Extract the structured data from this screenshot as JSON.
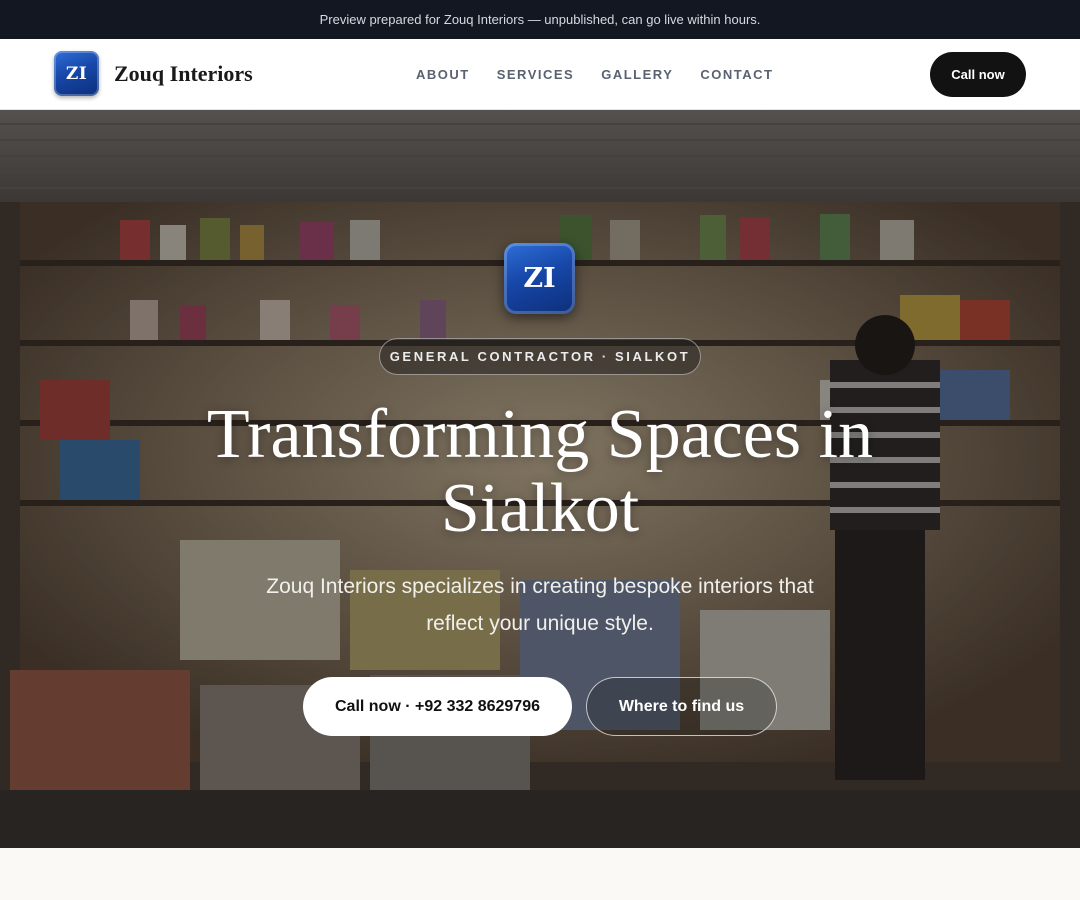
{
  "preview_bar": {
    "text": "Preview prepared for Zouq Interiors — unpublished, can go live within hours."
  },
  "header": {
    "logo_text": "ZI",
    "brand_name": "Zouq Interiors",
    "nav": [
      {
        "label": "ABOUT"
      },
      {
        "label": "SERVICES"
      },
      {
        "label": "GALLERY"
      },
      {
        "label": "CONTACT"
      }
    ],
    "call_label": "Call now"
  },
  "hero": {
    "logo_text": "ZI",
    "eyebrow": "GENERAL CONTRACTOR · SIALKOT",
    "title": "Transforming Spaces in Sialkot",
    "subtitle": "Zouq Interiors specializes in creating bespoke interiors that reflect your unique style.",
    "primary_cta": "Call now · +92 332 8629796",
    "secondary_cta": "Where to find us",
    "background": "shop-interior-photo"
  },
  "colors": {
    "preview_bar_bg": "#131722",
    "logo_blue": "#1747a8",
    "nav_link": "#5a6170",
    "call_button_bg": "#121212",
    "page_bg": "#faf9f6"
  }
}
